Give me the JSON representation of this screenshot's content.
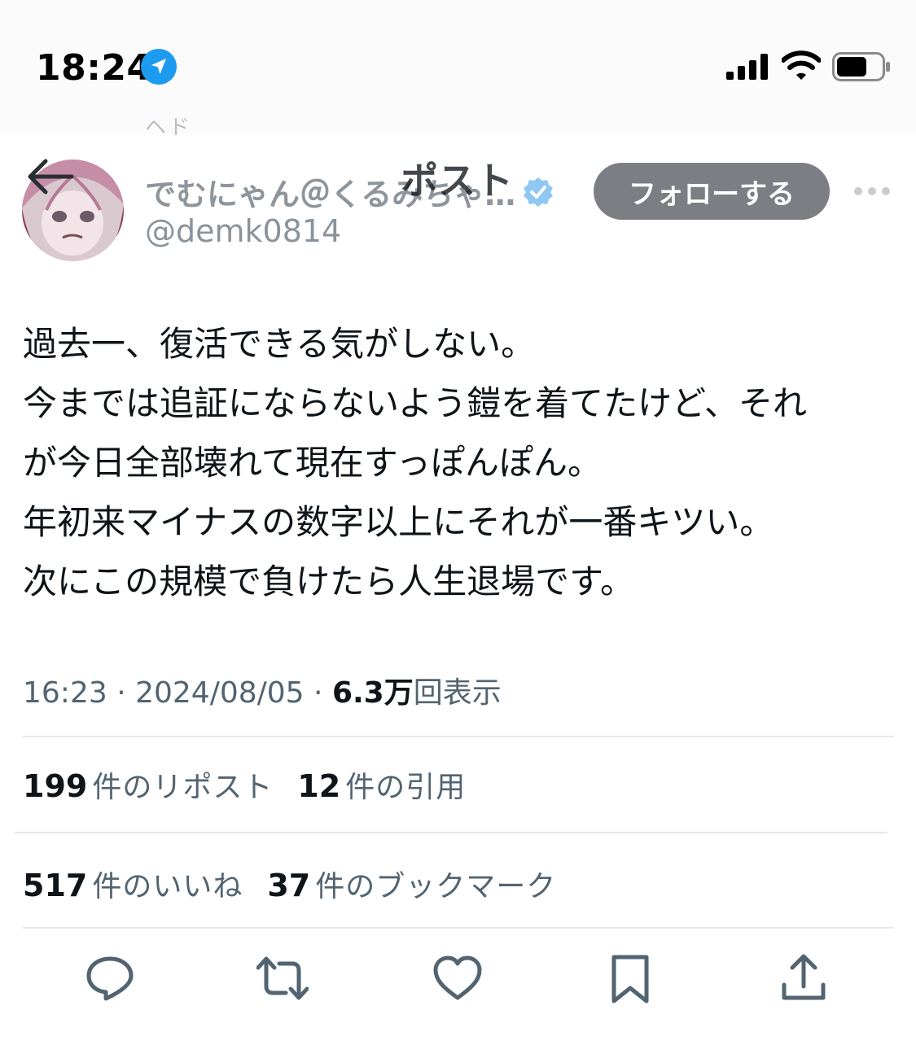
{
  "status_bar": {
    "time": "18:24"
  },
  "nav": {
    "ghost_text": "ヘド",
    "title": "ポスト"
  },
  "author": {
    "display_name": "でむにゃん＠くるみちゃ…",
    "handle": "@demk0814",
    "follow_label": "フォローする"
  },
  "post": {
    "lines": [
      "過去一、復活できる気がしない。",
      "今までは追証にならないよう鎧を着てたけど、それ",
      "が今日全部壊れて現在すっぽんぽん。",
      "年初来マイナスの数字以上にそれが一番キツい。",
      "次にこの規模で負けたら人生退場です。"
    ],
    "time": "16:23",
    "date": "2024/08/05",
    "views_count": "6.3万",
    "views_label": "回表示"
  },
  "stats": {
    "reposts_count": "199",
    "reposts_label": "件のリポスト",
    "quotes_count": "12",
    "quotes_label": "件の引用",
    "likes_count": "517",
    "likes_label": "件のいいね",
    "bookmarks_count": "37",
    "bookmarks_label": "件のブックマーク"
  },
  "colors": {
    "accent": "#1d9bf0",
    "text": "#0f1419",
    "secondary": "#536471",
    "follow_bg": "#7b7f83"
  },
  "icons": [
    "location-arrow-icon",
    "signal-icon",
    "wifi-icon",
    "battery-icon",
    "back-arrow-icon",
    "verified-badge-icon",
    "more-icon",
    "reply-icon",
    "retweet-icon",
    "like-icon",
    "bookmark-icon",
    "share-icon"
  ]
}
